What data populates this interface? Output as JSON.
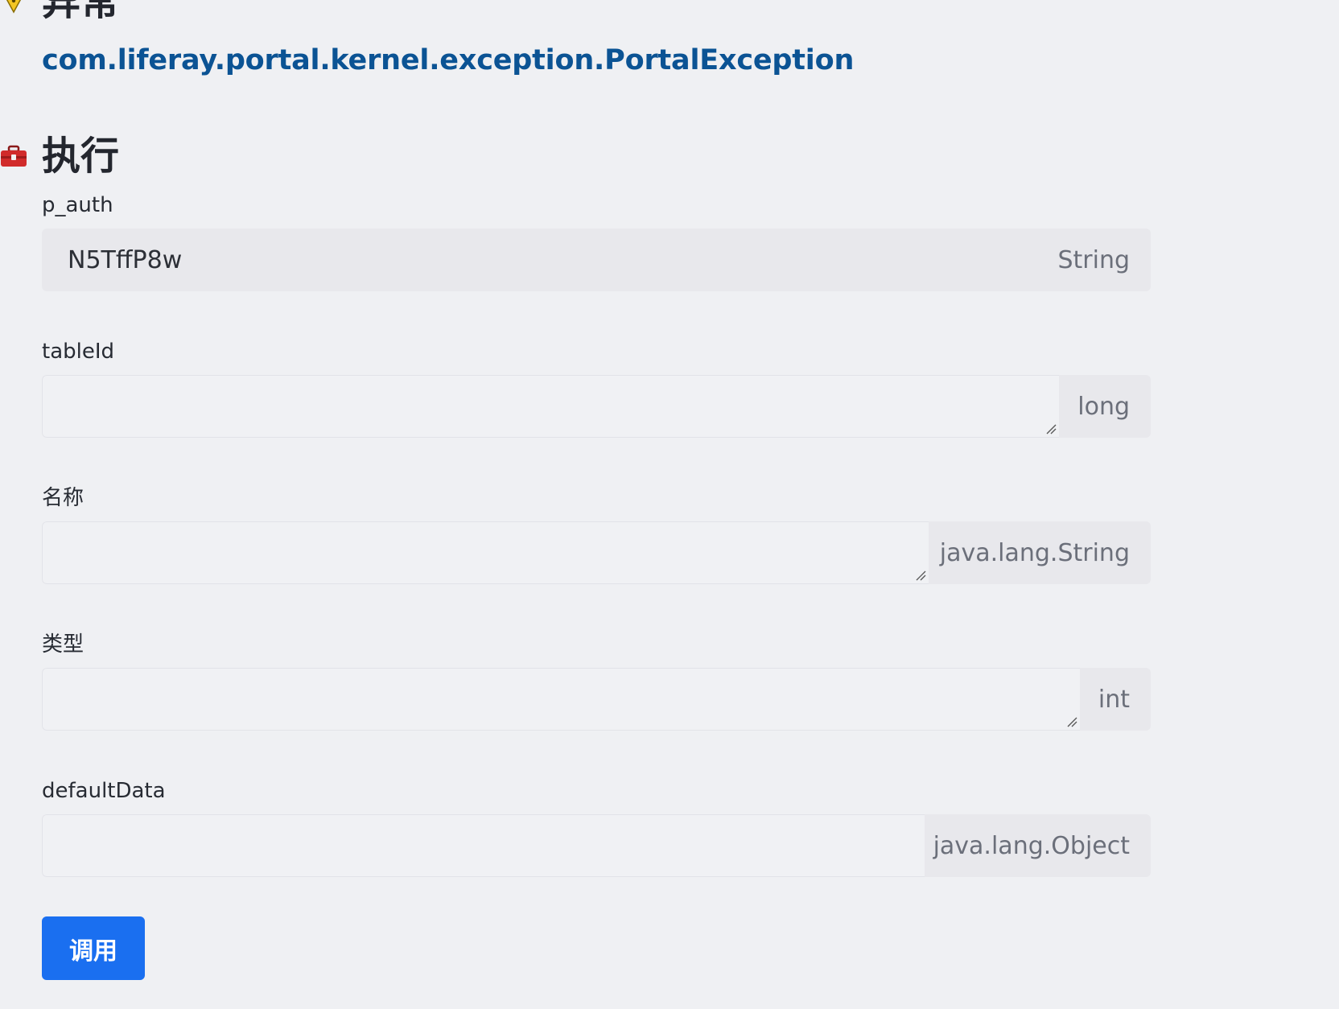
{
  "exception": {
    "heading": "异常",
    "icon": "warning-icon",
    "class_name": "com.liferay.portal.kernel.exception.PortalException"
  },
  "execute": {
    "heading": "执行",
    "icon": "toolbox-icon"
  },
  "fields": {
    "p_auth": {
      "label": "p_auth",
      "value": "N5TffP8w",
      "type": "String"
    },
    "tableId": {
      "label": "tableId",
      "value": "",
      "type": "long"
    },
    "name": {
      "label": "名称",
      "value": "",
      "type": "java.lang.String"
    },
    "type": {
      "label": "类型",
      "value": "",
      "type": "int"
    },
    "defaultData": {
      "label": "defaultData",
      "value": "",
      "type": "java.lang.Object"
    }
  },
  "actions": {
    "invoke_label": "调用"
  },
  "colors": {
    "background": "#eff0f3",
    "link": "#0b5394",
    "primary_button": "#1a6ff0",
    "addon_background": "#e8e8ec"
  }
}
